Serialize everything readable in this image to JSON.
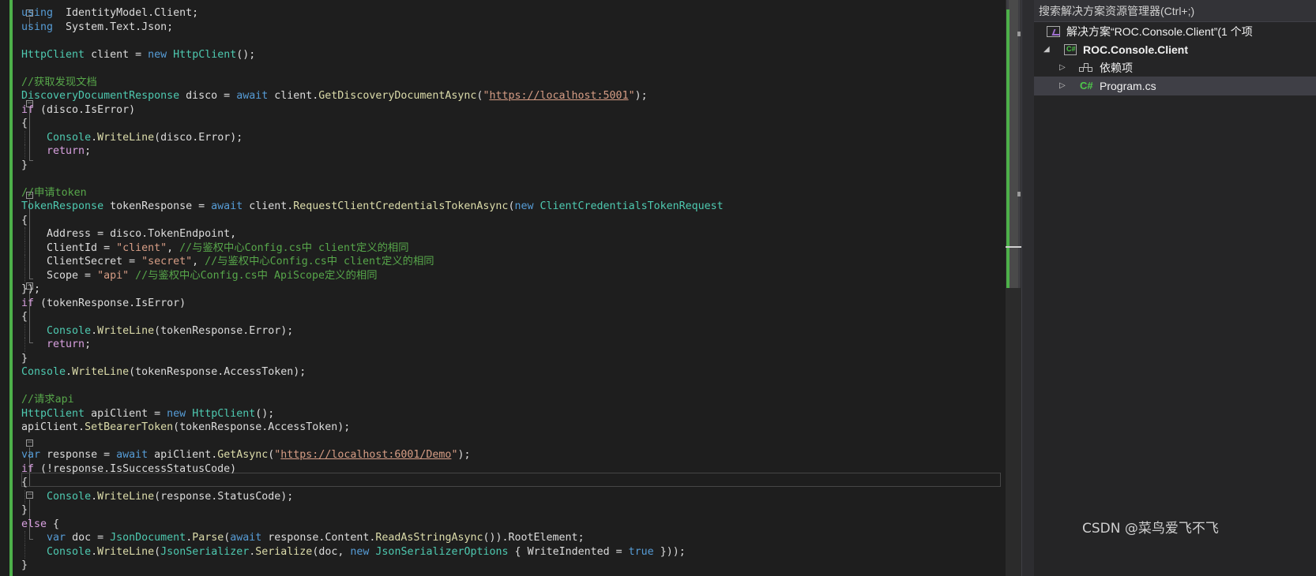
{
  "editor": {
    "lines": [
      [
        [
          "kw",
          "using"
        ],
        [
          "",
          "  IdentityModel.Client;"
        ]
      ],
      [
        [
          "kw",
          "using"
        ],
        [
          "",
          "  System.Text.Json;"
        ]
      ],
      [],
      [
        [
          "typ",
          "HttpClient"
        ],
        [
          "",
          " client = "
        ],
        [
          "kw",
          "new"
        ],
        [
          "",
          " "
        ],
        [
          "typ",
          "HttpClient"
        ],
        [
          "",
          "();"
        ]
      ],
      [],
      [
        [
          "cmt",
          "//获取发现文档"
        ]
      ],
      [
        [
          "typ",
          "DiscoveryDocumentResponse"
        ],
        [
          "",
          " disco = "
        ],
        [
          "kw",
          "await"
        ],
        [
          "",
          " client."
        ],
        [
          "mth",
          "GetDiscoveryDocumentAsync"
        ],
        [
          "",
          "("
        ],
        [
          "str",
          "\""
        ],
        [
          "url",
          "https://localhost:5001"
        ],
        [
          "str",
          "\""
        ],
        [
          "",
          ");"
        ]
      ],
      [
        [
          "ctl",
          "if"
        ],
        [
          "",
          " (disco.IsError)"
        ]
      ],
      [
        [
          "",
          "{"
        ]
      ],
      [
        [
          "",
          "    "
        ],
        [
          "typ",
          "Console"
        ],
        [
          "",
          "."
        ],
        [
          "mth",
          "WriteLine"
        ],
        [
          "",
          "(disco.Error);"
        ]
      ],
      [
        [
          "",
          "    "
        ],
        [
          "ctl",
          "return"
        ],
        [
          "",
          ";"
        ]
      ],
      [
        [
          "",
          "}"
        ]
      ],
      [],
      [
        [
          "cmt",
          "//申请token"
        ]
      ],
      [
        [
          "typ",
          "TokenResponse"
        ],
        [
          "",
          " tokenResponse = "
        ],
        [
          "kw",
          "await"
        ],
        [
          "",
          " client."
        ],
        [
          "mth",
          "RequestClientCredentialsTokenAsync"
        ],
        [
          "",
          "("
        ],
        [
          "kw",
          "new"
        ],
        [
          "",
          " "
        ],
        [
          "typ",
          "ClientCredentialsTokenRequest"
        ]
      ],
      [
        [
          "",
          "{"
        ]
      ],
      [
        [
          "",
          "    Address = disco.TokenEndpoint,"
        ]
      ],
      [
        [
          "",
          "    ClientId = "
        ],
        [
          "str",
          "\"client\""
        ],
        [
          "",
          ", "
        ],
        [
          "cmt",
          "//与鉴权中心Config.cs中 client定义的相同"
        ]
      ],
      [
        [
          "",
          "    ClientSecret = "
        ],
        [
          "str",
          "\"secret\""
        ],
        [
          "",
          ", "
        ],
        [
          "cmt",
          "//与鉴权中心Config.cs中 client定义的相同"
        ]
      ],
      [
        [
          "",
          "    Scope = "
        ],
        [
          "str",
          "\"api\""
        ],
        [
          "",
          " "
        ],
        [
          "cmt",
          "//与鉴权中心Config.cs中 ApiScope定义的相同"
        ]
      ],
      [
        [
          "",
          "});"
        ]
      ],
      [
        [
          "ctl",
          "if"
        ],
        [
          "",
          " (tokenResponse.IsError)"
        ]
      ],
      [
        [
          "",
          "{"
        ]
      ],
      [
        [
          "",
          "    "
        ],
        [
          "typ",
          "Console"
        ],
        [
          "",
          "."
        ],
        [
          "mth",
          "WriteLine"
        ],
        [
          "",
          "(tokenResponse.Error);"
        ]
      ],
      [
        [
          "",
          "    "
        ],
        [
          "ctl",
          "return"
        ],
        [
          "",
          ";"
        ]
      ],
      [
        [
          "",
          "}"
        ]
      ],
      [
        [
          "typ",
          "Console"
        ],
        [
          "",
          "."
        ],
        [
          "mth",
          "WriteLine"
        ],
        [
          "",
          "(tokenResponse.AccessToken);"
        ]
      ],
      [],
      [
        [
          "cmt",
          "//请求api"
        ]
      ],
      [
        [
          "typ",
          "HttpClient"
        ],
        [
          "",
          " apiClient = "
        ],
        [
          "kw",
          "new"
        ],
        [
          "",
          " "
        ],
        [
          "typ",
          "HttpClient"
        ],
        [
          "",
          "();"
        ]
      ],
      [
        [
          "",
          "apiClient."
        ],
        [
          "mth",
          "SetBearerToken"
        ],
        [
          "",
          "(tokenResponse.AccessToken);"
        ]
      ],
      [],
      [
        [
          "kw",
          "var"
        ],
        [
          "",
          " response = "
        ],
        [
          "kw",
          "await"
        ],
        [
          "",
          " apiClient."
        ],
        [
          "mth",
          "GetAsync"
        ],
        [
          "",
          "("
        ],
        [
          "str",
          "\""
        ],
        [
          "url",
          "https://localhost:6001/Demo"
        ],
        [
          "str",
          "\""
        ],
        [
          "",
          ");"
        ]
      ],
      [
        [
          "ctl",
          "if"
        ],
        [
          "",
          " (!response.IsSuccessStatusCode)"
        ]
      ],
      [
        [
          "",
          "{"
        ]
      ],
      [
        [
          "",
          "    "
        ],
        [
          "typ",
          "Console"
        ],
        [
          "",
          "."
        ],
        [
          "mth",
          "WriteLine"
        ],
        [
          "",
          "(response.StatusCode);"
        ]
      ],
      [
        [
          "",
          "}"
        ]
      ],
      [
        [
          "ctl",
          "else"
        ],
        [
          "",
          " {"
        ]
      ],
      [
        [
          "",
          "    "
        ],
        [
          "kw",
          "var"
        ],
        [
          "",
          " doc = "
        ],
        [
          "typ",
          "JsonDocument"
        ],
        [
          "",
          "."
        ],
        [
          "mth",
          "Parse"
        ],
        [
          "",
          "("
        ],
        [
          "kw",
          "await"
        ],
        [
          "",
          " response.Content."
        ],
        [
          "mth",
          "ReadAsStringAsync"
        ],
        [
          "",
          "()).RootElement;"
        ]
      ],
      [
        [
          "",
          "    "
        ],
        [
          "typ",
          "Console"
        ],
        [
          "",
          "."
        ],
        [
          "mth",
          "WriteLine"
        ],
        [
          "",
          "("
        ],
        [
          "typ",
          "JsonSerializer"
        ],
        [
          "",
          "."
        ],
        [
          "mth",
          "Serialize"
        ],
        [
          "",
          "(doc, "
        ],
        [
          "kw",
          "new"
        ],
        [
          "",
          " "
        ],
        [
          "typ",
          "JsonSerializerOptions"
        ],
        [
          "",
          " { WriteIndented = "
        ],
        [
          "kw",
          "true"
        ],
        [
          "",
          " }));"
        ]
      ],
      [
        [
          "",
          "}"
        ]
      ]
    ]
  },
  "solution_explorer": {
    "search_placeholder": "搜索解决方案资源管理器(Ctrl+;)",
    "solution_label": "解决方案“ROC.Console.Client”(1 个项",
    "project_label": "ROC.Console.Client",
    "dependencies_label": "依赖项",
    "program_label": "Program.cs",
    "icons": [
      "solution-icon",
      "csharp-project-icon",
      "dependencies-icon",
      "csharp-file-icon"
    ]
  },
  "watermark": "CSDN @菜鸟爱飞不飞",
  "colors": {
    "keyword": "#569cd6",
    "control": "#d8a0df",
    "type": "#4ec9b0",
    "method": "#dcdcaa",
    "string": "#d69d85",
    "comment": "#57a64a",
    "change_bar": "#4db04a"
  }
}
